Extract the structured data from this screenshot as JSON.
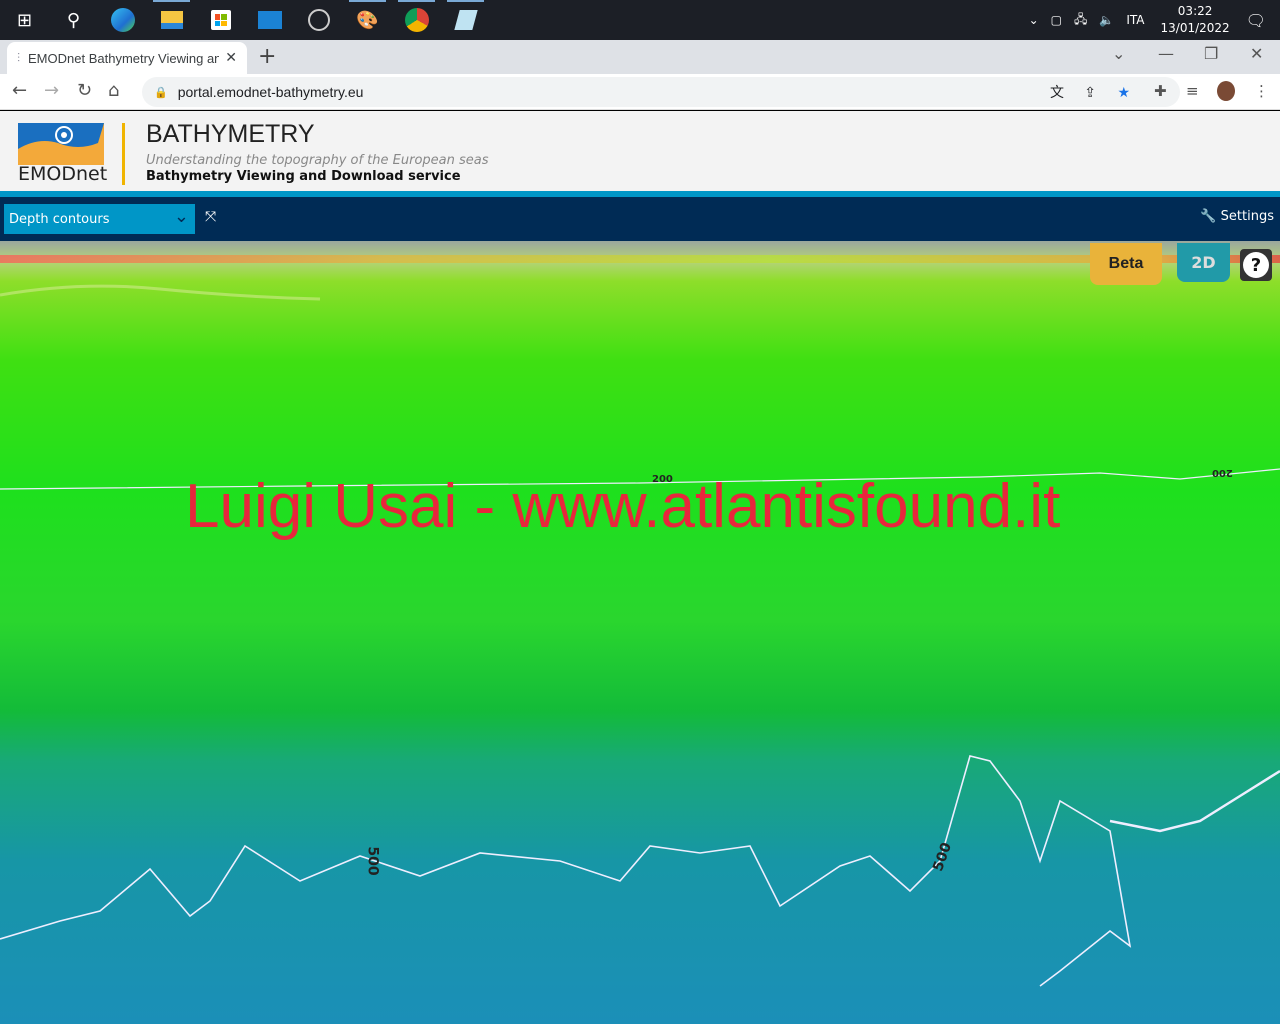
{
  "taskbar": {
    "apps": [
      "start",
      "search",
      "edge",
      "file-explorer",
      "store",
      "mail",
      "obs",
      "paint",
      "chrome",
      "notepad"
    ],
    "tray": {
      "language": "ITA",
      "time": "03:22",
      "date": "13/01/2022"
    }
  },
  "browser": {
    "tab_title": "EMODnet Bathymetry Viewing and Download service",
    "url": "portal.emodnet-bathymetry.eu"
  },
  "header": {
    "logo_text": "EMODnet",
    "title": "BATHYMETRY",
    "subtitle": "Understanding the topography of the European seas",
    "service": "Bathymetry Viewing and Download service"
  },
  "appbar": {
    "layer_select": "Depth contours",
    "settings_label": "Settings"
  },
  "map": {
    "beta_label": "Beta",
    "mode_label": "2D",
    "help_label": "?",
    "watermark": "Luigi Usai - www.atlantisfound.it",
    "contour_labels": [
      "200",
      "200",
      "500",
      "500"
    ]
  },
  "colors": {
    "navy": "#002b55",
    "accent": "#0096c7",
    "beta": "#e9b33a",
    "watermark": "#e8263c"
  }
}
